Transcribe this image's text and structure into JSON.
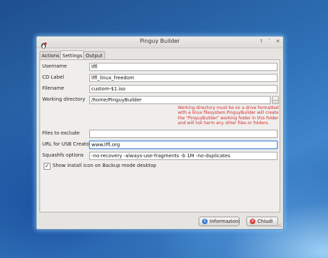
{
  "window": {
    "title": "Pinguy Builder",
    "controls": {
      "help": "?",
      "minimize": "ˇ",
      "close": "✕"
    }
  },
  "tabs": [
    {
      "label": "Actions",
      "active": false
    },
    {
      "label": "Settings",
      "active": true
    },
    {
      "label": "Output",
      "active": false
    }
  ],
  "settings": {
    "username": {
      "label": "Username",
      "value": "lffl"
    },
    "cd_label": {
      "label": "CD Label",
      "value": "lffl_linux_freedom"
    },
    "filename": {
      "label": "Filename",
      "value": "custom-$1.iso"
    },
    "working_directory": {
      "label": "Working directory",
      "value": "/home/PinguyBuilder",
      "browse_label": "..."
    },
    "warning": "Working directory must be on a drive formatted\nwith a linux filesystem.PinguyBuilder will create\nthe \"PinguyBuilder\" working folder in this folder\nand will not harm any other files or folders.",
    "files_to_exclude": {
      "label": "Files to exclude",
      "value": ""
    },
    "usb_url": {
      "label": "URL for USB Creator",
      "value": "www.lffl.org"
    },
    "squashfs_options": {
      "label": "Squashfs options",
      "value": "-no-recovery -always-use-fragments -b 1M -no-duplicates"
    },
    "show_install_icon": {
      "label": "Show install icon on Backup mode desktop",
      "checked": true
    }
  },
  "buttons": {
    "info": {
      "label": "Informazioni",
      "icon": "info-icon"
    },
    "close": {
      "label": "Chiudi",
      "icon": "close-icon"
    }
  },
  "colors": {
    "warning_text": "#d42a2a",
    "focus_border": "#4a8ad6",
    "close_button_icon": "#d64040",
    "info_button_icon": "#3b7fd0"
  }
}
